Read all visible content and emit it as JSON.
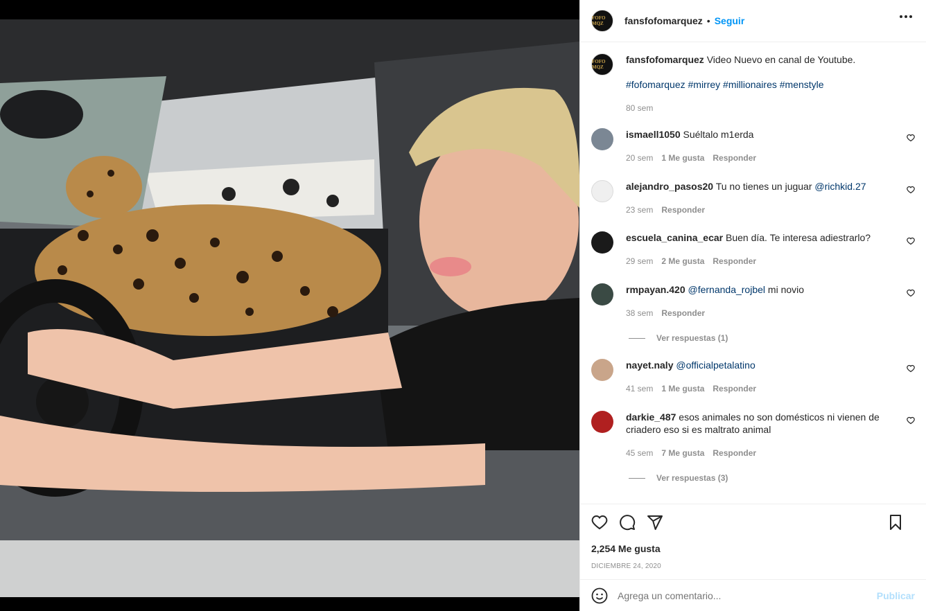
{
  "post": {
    "username": "fansfofomarquez",
    "follow": "Seguir",
    "avatar_text": "FOFO MQZ",
    "caption": "Video Nuevo en canal de Youtube.",
    "hashtags": "#fofomarquez #mirrey #millionaires #menstyle",
    "caption_age": "80 sem",
    "likes": "2,254 Me gusta",
    "date": "DICIEMBRE 24, 2020"
  },
  "comments": [
    {
      "user": "ismaell1050",
      "text": "Suéltalo m1erda",
      "mention": "",
      "after": "",
      "age": "20 sem",
      "likes": "1 Me gusta",
      "reply": "Responder",
      "avatar_color": "#7b8794"
    },
    {
      "user": "alejandro_pasos20",
      "text": "Tu no tienes un juguar ",
      "mention": "@richkid.27",
      "after": "",
      "age": "23 sem",
      "likes": "",
      "reply": "Responder",
      "avatar_color": "#dbdbdb"
    },
    {
      "user": "escuela_canina_ecar",
      "text": "Buen día. Te interesa adiestrarlo?",
      "mention": "",
      "after": "",
      "age": "29 sem",
      "likes": "2 Me gusta",
      "reply": "Responder",
      "avatar_color": "#1a1a1a"
    },
    {
      "user": "rmpayan.420",
      "text": "",
      "mention": "@fernanda_rojbel",
      "after": " mi novio",
      "age": "38 sem",
      "likes": "",
      "reply": "Responder",
      "avatar_color": "#3a4a44",
      "view_replies": "Ver respuestas (1)"
    },
    {
      "user": "nayet.naly",
      "text": "",
      "mention": "@officialpetalatino",
      "after": "",
      "age": "41 sem",
      "likes": "1 Me gusta",
      "reply": "Responder",
      "avatar_color": "#c9a58a"
    },
    {
      "user": "darkie_487",
      "text": "esos animales no son domésticos ni vienen de criadero eso si es maltrato animal",
      "mention": "",
      "after": "",
      "age": "45 sem",
      "likes": "7 Me gusta",
      "reply": "Responder",
      "avatar_color": "#b02020",
      "view_replies": "Ver respuestas (3)"
    }
  ],
  "composer": {
    "placeholder": "Agrega un comentario...",
    "publish": "Publicar"
  },
  "icons": {
    "emoji": "emoji-icon",
    "like": "heart-icon",
    "comment": "comment-icon",
    "share": "share-icon",
    "save": "bookmark-icon"
  }
}
